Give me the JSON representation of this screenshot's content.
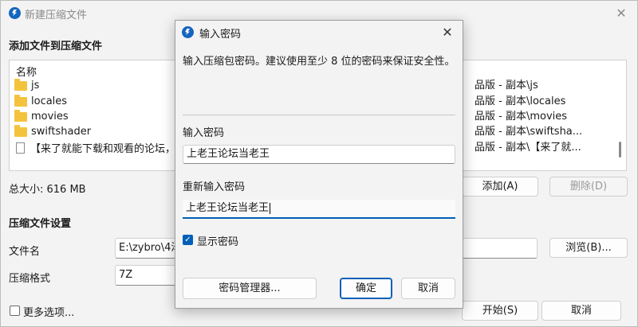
{
  "background_window": {
    "title": "新建压缩文件",
    "add_files_label": "添加文件到压缩文件",
    "file_list": {
      "column_header": "名称",
      "rows": [
        {
          "name": "js",
          "type": "folder",
          "path": "品版 - 副本\\js"
        },
        {
          "name": "locales",
          "type": "folder",
          "path": "品版 - 副本\\locales"
        },
        {
          "name": "movies",
          "type": "folder",
          "path": "品版 - 副本\\movies"
        },
        {
          "name": "swiftshader",
          "type": "folder",
          "path": "品版 - 副本\\swiftsha..."
        },
        {
          "name": "【来了就能下载和观看的论坛，纯",
          "type": "file",
          "path": "品版 - 副本\\【来了就..."
        }
      ]
    },
    "total_size": "总大小: 616 MB",
    "add_button": "添加(A)",
    "delete_button": "删除(D)",
    "settings_label": "压缩文件设置",
    "filename_label": "文件名",
    "filename_value": "E:\\zybro\\4泽",
    "browse_button": "浏览(B)...",
    "format_label": "压缩格式",
    "format_value": "7Z",
    "more_options_label": "更多选项...",
    "start_button": "开始(S)",
    "cancel_button": "取消"
  },
  "dialog": {
    "title": "输入密码",
    "info_text": "输入压缩包密码。建议使用至少 8 位的密码来保证安全性。",
    "password_label": "输入密码",
    "password_value": "上老王论坛当老王",
    "confirm_label": "重新输入密码",
    "confirm_value": "上老王论坛当老王",
    "show_password_label": "显示密码",
    "show_password_checked": true,
    "password_manager_button": "密码管理器...",
    "ok_button": "确定",
    "cancel_button": "取消"
  },
  "colors": {
    "accent": "#005fb8",
    "folder": "#f4c33e",
    "logo": "#1565c0"
  }
}
